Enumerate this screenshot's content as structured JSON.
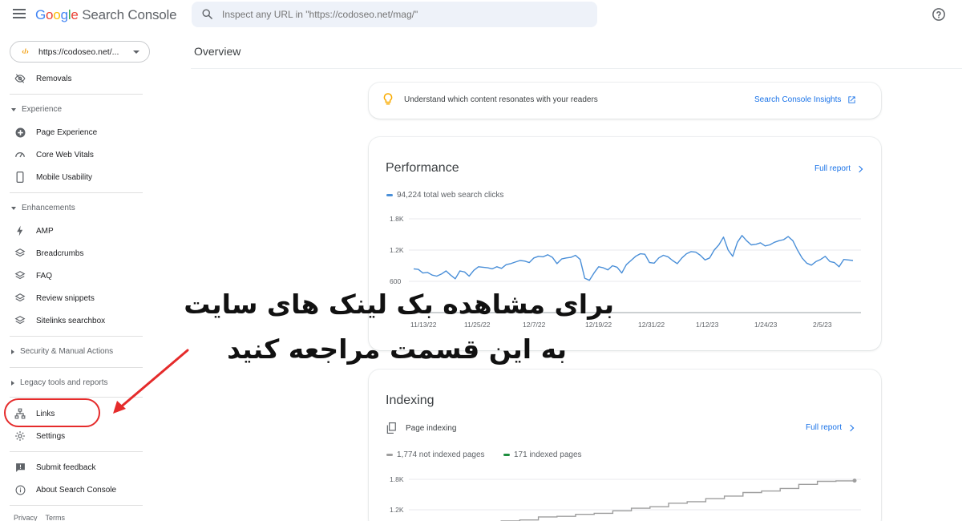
{
  "header": {
    "logo_parts": [
      "G",
      "o",
      "o",
      "g",
      "l",
      "e"
    ],
    "product": "Search Console",
    "search_placeholder": "Inspect any URL in \"https://codoseo.net/mag/\""
  },
  "sidebar": {
    "property": "https://codoseo.net/...",
    "removals": "Removals",
    "experience_section": "Experience",
    "experience_items": [
      "Page Experience",
      "Core Web Vitals",
      "Mobile Usability"
    ],
    "enhancements_section": "Enhancements",
    "enhancement_items": [
      "AMP",
      "Breadcrumbs",
      "FAQ",
      "Review snippets",
      "Sitelinks searchbox"
    ],
    "security_section": "Security & Manual Actions",
    "legacy_section": "Legacy tools and reports",
    "links": "Links",
    "settings": "Settings",
    "submit_feedback": "Submit feedback",
    "about": "About Search Console",
    "footer": [
      "Privacy",
      "Terms"
    ]
  },
  "main": {
    "title": "Overview",
    "insights_text": "Understand which content resonates with your readers",
    "insights_link": "Search Console Insights",
    "performance": {
      "title": "Performance",
      "full_report": "Full report",
      "legend": "94,224 total web search clicks"
    },
    "indexing": {
      "title": "Indexing",
      "subtitle": "Page indexing",
      "full_report": "Full report",
      "legend_not_indexed": "1,774 not indexed pages",
      "legend_indexed": "171 indexed pages"
    }
  },
  "colors": {
    "accent": "#1a73e8",
    "clicks_line": "#4a8fd8",
    "not_indexed": "#9e9e9e",
    "indexed": "#1e8e3e",
    "annotation": "#e52b2b"
  },
  "annotation": {
    "line1": "برای مشاهده بک لینک های سایت",
    "line2": "به این قسمت مراجعه کنید"
  },
  "chart_data": [
    {
      "type": "line",
      "series": [
        {
          "name": "94,224 total web search clicks",
          "values": [
            840,
            830,
            760,
            770,
            720,
            700,
            740,
            800,
            720,
            650,
            800,
            780,
            700,
            810,
            880,
            870,
            860,
            840,
            880,
            850,
            920,
            940,
            970,
            1000,
            990,
            960,
            1050,
            1080,
            1070,
            1110,
            1060,
            940,
            1030,
            1050,
            1060,
            1100,
            1020,
            660,
            620,
            760,
            880,
            860,
            820,
            900,
            870,
            760,
            920,
            1000,
            1080,
            1130,
            1120,
            960,
            950,
            1050,
            1100,
            1070,
            1000,
            940,
            1050,
            1130,
            1170,
            1160,
            1100,
            1010,
            1050,
            1200,
            1300,
            1450,
            1200,
            1080,
            1350,
            1480,
            1380,
            1300,
            1310,
            1340,
            1280,
            1300,
            1350,
            1380,
            1400,
            1460,
            1380,
            1200,
            1050,
            950,
            910,
            980,
            1020,
            1080,
            980,
            960,
            880,
            1020,
            1010,
            1000
          ]
        }
      ],
      "x_tick_labels": [
        "11/13/22",
        "11/25/22",
        "12/7/22",
        "12/19/22",
        "12/31/22",
        "1/12/23",
        "1/24/23",
        "2/5/23"
      ],
      "y_tick_labels": [
        "600",
        "1.2K",
        "1.8K"
      ],
      "ylim": [
        600,
        1800
      ],
      "grid": true
    },
    {
      "type": "line",
      "series": [
        {
          "name": "1,774 not indexed pages",
          "values": [
            950,
            980,
            1000,
            1060,
            1070,
            1110,
            1130,
            1180,
            1230,
            1260,
            1330,
            1360,
            1420,
            1470,
            1540,
            1570,
            1620,
            1700,
            1760,
            1770,
            1774
          ]
        }
      ],
      "y_tick_labels": [
        "1.2K",
        "1.8K"
      ],
      "ylim": [
        600,
        1800
      ],
      "grid": true
    }
  ]
}
